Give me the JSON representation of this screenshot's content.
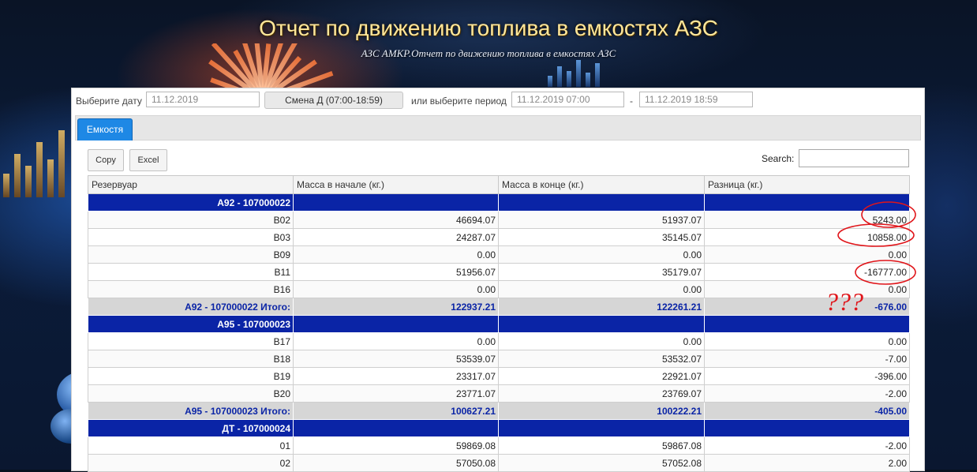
{
  "header": {
    "title": "Отчет по движению топлива в емкостях АЗС",
    "subtitle": "АЗС АМКР.Отчет по движению топлива в емкостях АЗС"
  },
  "filters": {
    "date_label": "Выберите дату",
    "date_value": "11.12.2019",
    "shift_label": "Смена Д (07:00-18:59)",
    "period_label": "или выберите период",
    "period_from": "11.12.2019 07:00",
    "period_sep": "-",
    "period_to": "11.12.2019 18:59"
  },
  "tabs": [
    {
      "label": "Емкостя",
      "active": true
    }
  ],
  "toolbar": {
    "copy_label": "Copy",
    "excel_label": "Excel",
    "search_label": "Search:",
    "search_value": ""
  },
  "table": {
    "columns": [
      "Резервуар",
      "Масса в начале (кг.)",
      "Масса в конце (кг.)",
      "Разница (кг.)"
    ],
    "groups": [
      {
        "name": "А92 - 107000022",
        "rows": [
          [
            "В02",
            "46694.07",
            "51937.07",
            "5243.00"
          ],
          [
            "В03",
            "24287.07",
            "35145.07",
            "10858.00"
          ],
          [
            "В09",
            "0.00",
            "0.00",
            "0.00"
          ],
          [
            "В11",
            "51956.07",
            "35179.07",
            "-16777.00"
          ],
          [
            "В16",
            "0.00",
            "0.00",
            "0.00"
          ]
        ],
        "total": [
          "А92 - 107000022 Итого:",
          "122937.21",
          "122261.21",
          "-676.00"
        ]
      },
      {
        "name": "А95 - 107000023",
        "rows": [
          [
            "В17",
            "0.00",
            "0.00",
            "0.00"
          ],
          [
            "В18",
            "53539.07",
            "53532.07",
            "-7.00"
          ],
          [
            "В19",
            "23317.07",
            "22921.07",
            "-396.00"
          ],
          [
            "В20",
            "23771.07",
            "23769.07",
            "-2.00"
          ]
        ],
        "total": [
          "А95 - 107000023 Итого:",
          "100627.21",
          "100222.21",
          "-405.00"
        ]
      },
      {
        "name": "ДТ - 107000024",
        "rows": [
          [
            "01",
            "59869.08",
            "59867.08",
            "-2.00"
          ],
          [
            "02",
            "57050.08",
            "57052.08",
            "2.00"
          ]
        ]
      }
    ]
  },
  "annotation": {
    "marks": "???",
    "color": "#e0151a"
  }
}
